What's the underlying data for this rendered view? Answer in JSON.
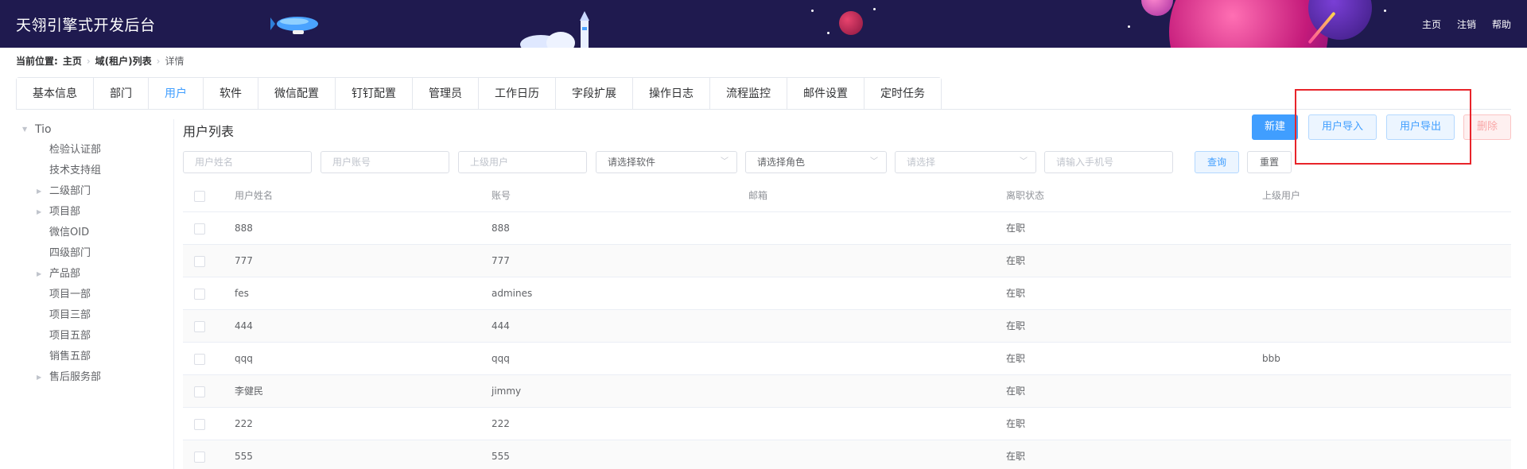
{
  "header": {
    "brand": "天翎引擎式开发后台",
    "nav": [
      "主页",
      "注销",
      "帮助"
    ]
  },
  "breadcrumb": {
    "label": "当前位置:",
    "items": [
      "主页",
      "域(租户)列表",
      "详情"
    ]
  },
  "tabs": [
    "基本信息",
    "部门",
    "用户",
    "软件",
    "微信配置",
    "钉钉配置",
    "管理员",
    "工作日历",
    "字段扩展",
    "操作日志",
    "流程监控",
    "邮件设置",
    "定时任务"
  ],
  "active_tab": "用户",
  "tree": {
    "root": "Tio",
    "children": [
      {
        "label": "检验认证部",
        "expandable": false
      },
      {
        "label": "技术支持组",
        "expandable": false
      },
      {
        "label": "二级部门",
        "expandable": true
      },
      {
        "label": "项目部",
        "expandable": true
      },
      {
        "label": "微信OID",
        "expandable": false
      },
      {
        "label": "四级部门",
        "expandable": false
      },
      {
        "label": "产品部",
        "expandable": true
      },
      {
        "label": "项目一部",
        "expandable": false
      },
      {
        "label": "项目三部",
        "expandable": false
      },
      {
        "label": "项目五部",
        "expandable": false
      },
      {
        "label": "销售五部",
        "expandable": false
      },
      {
        "label": "售后服务部",
        "expandable": true
      }
    ]
  },
  "main": {
    "title": "用户列表",
    "buttons": {
      "new": "新建",
      "import": "用户导入",
      "export": "用户导出",
      "delete": "删除"
    },
    "filters": {
      "name_placeholder": "用户姓名",
      "account_placeholder": "用户账号",
      "superior_placeholder": "上级用户",
      "software_select": "请选择软件",
      "role_select": "请选择角色",
      "generic_select": "请选择",
      "phone_placeholder": "请输入手机号",
      "query": "查询",
      "reset": "重置"
    },
    "table": {
      "columns": [
        "用户姓名",
        "账号",
        "邮箱",
        "离职状态",
        "上级用户"
      ],
      "rows": [
        [
          "888",
          "888",
          "",
          "在职",
          ""
        ],
        [
          "777",
          "777",
          "",
          "在职",
          ""
        ],
        [
          "fes",
          "admines",
          "",
          "在职",
          ""
        ],
        [
          "444",
          "444",
          "",
          "在职",
          ""
        ],
        [
          "qqq",
          "qqq",
          "",
          "在职",
          "bbb"
        ],
        [
          "李健民",
          "jimmy",
          "",
          "在职",
          ""
        ],
        [
          "222",
          "222",
          "",
          "在职",
          ""
        ],
        [
          "555",
          "555",
          "",
          "在职",
          ""
        ]
      ]
    }
  },
  "colors": {
    "header_bg": "#1f1a4f",
    "primary": "#409eff",
    "danger_light": "#fef0f0",
    "highlight": "#e8242a"
  }
}
